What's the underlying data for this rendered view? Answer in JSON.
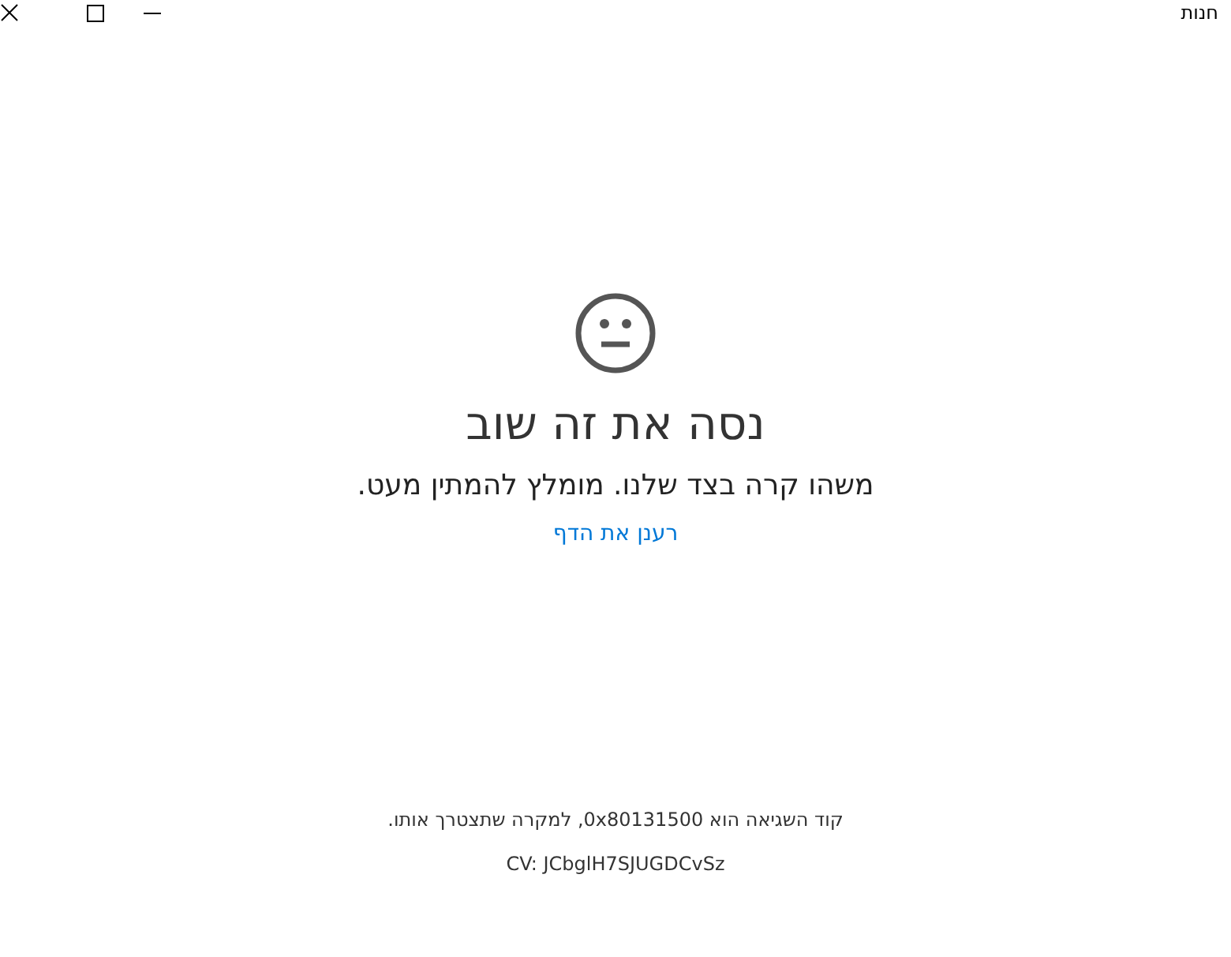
{
  "window": {
    "title": "חנות"
  },
  "error": {
    "heading": "נסה את זה שוב",
    "message": "משהו קרה בצד שלנו. מומלץ להמתין מעט.",
    "link": "רענן את הדף"
  },
  "footer": {
    "code_text": "קוד השגיאה הוא 0x80131500, למקרה שתצטרך אותו.",
    "cv": "CV: JCbglH7SJUGDCvSz"
  }
}
